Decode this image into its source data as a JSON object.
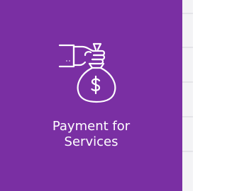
{
  "tile": {
    "label": "Payment for\nServices",
    "icon": "hand-money-bag-icon",
    "background_color": "#7a2fa3",
    "foreground_color": "#ffffff"
  }
}
